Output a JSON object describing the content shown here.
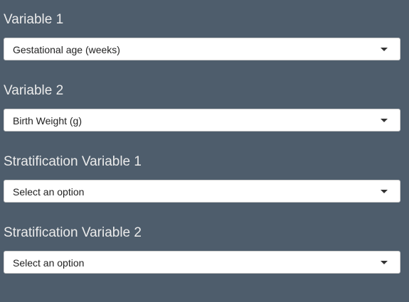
{
  "fields": [
    {
      "label": "Variable 1",
      "value": "Gestational age (weeks)"
    },
    {
      "label": "Variable 2",
      "value": "Birth Weight (g)"
    },
    {
      "label": "Stratification Variable 1",
      "value": "Select an option"
    },
    {
      "label": "Stratification Variable 2",
      "value": "Select an option"
    }
  ],
  "icons": {
    "dropdown": "caret-down-icon"
  },
  "colors": {
    "background": "#4e5d6c",
    "label_text": "#ebebeb",
    "select_bg": "#ffffff"
  }
}
